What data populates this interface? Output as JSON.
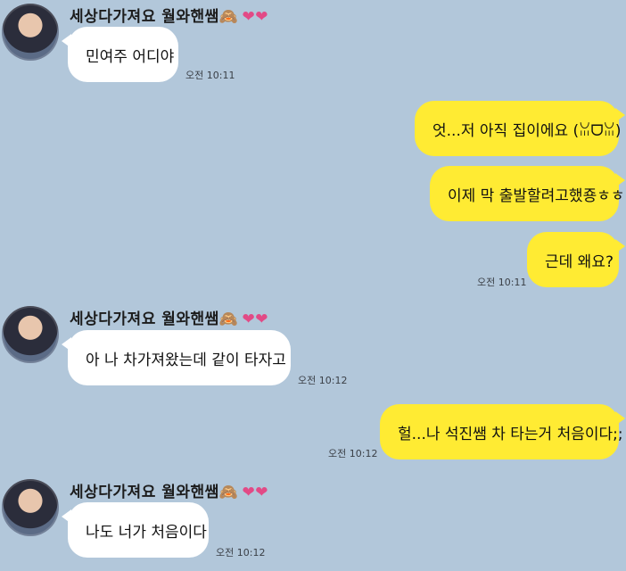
{
  "sender_name": "세상다가져요 월와핸쌤🙈",
  "sender_hearts": "❤❤",
  "messages": [
    {
      "text": "민여주 어디야",
      "time": "오전 10:11"
    },
    {
      "text": "엇...저 아직 집이에요 (ꈍᗜꈍ)"
    },
    {
      "text": "이제 막 출발할려고했죵ㅎㅎ"
    },
    {
      "text": "근데 왜요?",
      "time": "오전 10:11"
    },
    {
      "text": "아 나 차가져왔는데 같이 타자고",
      "time": "오전 10:12"
    },
    {
      "text": "헐...나 석진쌤 차 타는거 처음이다;;",
      "time": "오전 10:12"
    },
    {
      "text": "나도 너가 처음이다",
      "time": "오전 10:12"
    }
  ]
}
